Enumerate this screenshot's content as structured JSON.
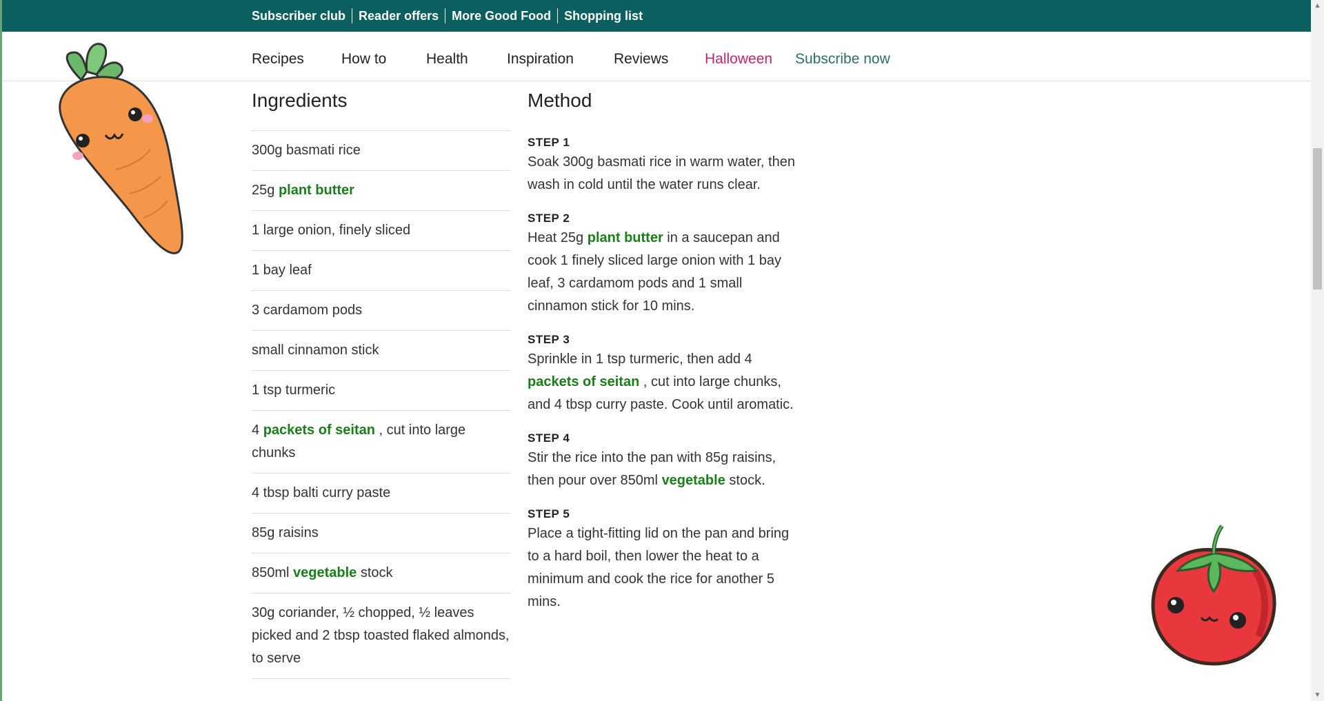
{
  "top_links": [
    "Subscriber club",
    "Reader offers",
    "More Good Food",
    "Shopping list"
  ],
  "nav": {
    "recipes": "Recipes",
    "how_to": "How to",
    "health": "Health",
    "inspiration": "Inspiration",
    "reviews": "Reviews",
    "halloween": "Halloween",
    "subscribe": "Subscribe now"
  },
  "ingredients": {
    "title": "Ingredients",
    "items": {
      "i0": "300g basmati rice",
      "i1_pre": "25g ",
      "i1_link": "plant butter",
      "i2": "1 large onion, finely sliced",
      "i3": "1 bay leaf",
      "i4": "3 cardamom pods",
      "i5": "small cinnamon stick",
      "i6": "1 tsp turmeric",
      "i7_pre": "4 ",
      "i7_link": "packets of seitan",
      "i7_post": " , cut into large chunks",
      "i8": "4 tbsp balti curry paste",
      "i9": "85g raisins",
      "i10_pre": "850ml ",
      "i10_link": "vegetable",
      "i10_post": " stock",
      "i11": "30g coriander, ½ chopped, ½ leaves picked and 2 tbsp toasted flaked almonds, to serve"
    }
  },
  "method": {
    "title": "Method",
    "s1_label": "STEP 1",
    "s1_text": "Soak 300g basmati rice in warm water, then wash in cold until the water runs clear.",
    "s2_label": "STEP 2",
    "s2_pre": "Heat 25g ",
    "s2_link": "plant butter",
    "s2_post": " in a saucepan and cook 1 finely sliced large onion with 1 bay leaf, 3 cardamom pods and 1 small cinnamon stick for 10 mins.",
    "s3_label": "STEP 3",
    "s3_pre": "Sprinkle in 1 tsp turmeric, then add 4 ",
    "s3_link": "packets of seitan",
    "s3_post": " , cut into large chunks, and 4 tbsp curry paste. Cook until aromatic.",
    "s4_label": "STEP 4",
    "s4_pre": "Stir the rice into the pan with 85g raisins, then pour over 850ml ",
    "s4_link": "vegetable",
    "s4_post": " stock.",
    "s5_label": "STEP 5",
    "s5_text": "Place a tight-fitting lid on the pan and bring to a hard boil, then lower the heat to a minimum and cook the rice for another 5 mins."
  },
  "decor": {
    "carrot_icon": "carrot-sticker-icon",
    "tomato_icon": "tomato-sticker-icon",
    "carrot_color": "#f5974a",
    "tomato_color": "#e8383d"
  },
  "colors": {
    "topbar": "#0b5f5f",
    "link_green": "#1a7e1a",
    "halloween": "#c0266f",
    "subscribe": "#2f6f5d"
  }
}
